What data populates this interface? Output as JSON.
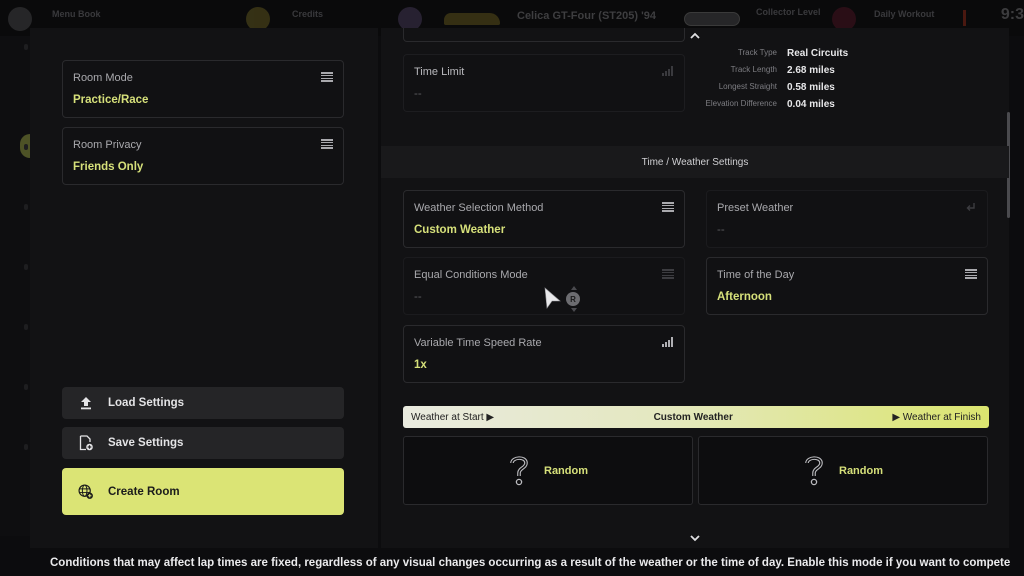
{
  "topbar": {
    "profile_label": "Menu Book",
    "credits_label": "Credits",
    "car_name": "Celica GT-Four (ST205) '94",
    "collector_label": "Collector Level",
    "workout_label": "Daily Workout",
    "clock": "9:3"
  },
  "left": {
    "room_mode": {
      "label": "Room Mode",
      "value": "Practice/Race"
    },
    "room_privacy": {
      "label": "Room Privacy",
      "value": "Friends Only"
    },
    "buttons": {
      "load": "Load Settings",
      "save": "Save Settings",
      "create": "Create Room"
    }
  },
  "right": {
    "time_limit": {
      "label": "Time Limit",
      "value": "--"
    },
    "track_info": [
      {
        "key": "Track Type",
        "value": "Real Circuits"
      },
      {
        "key": "Track Length",
        "value": "2.68 miles"
      },
      {
        "key": "Longest Straight",
        "value": "0.58 miles"
      },
      {
        "key": "Elevation Difference",
        "value": "0.04 miles"
      }
    ],
    "section_title": "Time / Weather Settings",
    "weather_method": {
      "label": "Weather Selection Method",
      "value": "Custom Weather"
    },
    "preset_weather": {
      "label": "Preset Weather",
      "value": "--"
    },
    "equal_conditions": {
      "label": "Equal Conditions Mode",
      "value": "--"
    },
    "time_of_day": {
      "label": "Time of the Day",
      "value": "Afternoon"
    },
    "time_speed": {
      "label": "Variable Time Speed Rate",
      "value": "1x"
    },
    "weather_bar": {
      "start": "Weather at Start ▶",
      "center": "Custom Weather",
      "finish": "▶ Weather at Finish"
    },
    "weather_start": {
      "icon": "question-icon",
      "value": "Random"
    },
    "weather_finish": {
      "icon": "question-icon",
      "value": "Random"
    },
    "cursor_badge": "R"
  },
  "footer": {
    "help_text": "Conditions that may affect lap times are fixed, regardless of any visual changes occurring as a result of the weather or the time of day. Enable this mode if you want to compete"
  },
  "colors": {
    "accent": "#dbe475",
    "value_text": "#d6e07a",
    "panel_bg": "#121214"
  }
}
